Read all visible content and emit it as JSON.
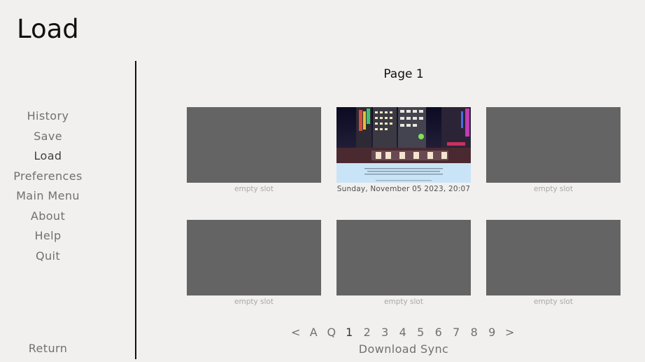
{
  "screen": {
    "title": "Load"
  },
  "nav": {
    "items": [
      {
        "label": "History"
      },
      {
        "label": "Save"
      },
      {
        "label": "Load"
      },
      {
        "label": "Preferences"
      },
      {
        "label": "Main Menu"
      },
      {
        "label": "About"
      },
      {
        "label": "Help"
      },
      {
        "label": "Quit"
      }
    ],
    "active": "Load",
    "return_label": "Return"
  },
  "page": {
    "label": "Page 1"
  },
  "slots": [
    {
      "caption": "empty slot",
      "empty": true
    },
    {
      "caption": "Sunday, November 05 2023, 20:07",
      "empty": false,
      "thumbnail": "night-street-scene"
    },
    {
      "caption": "empty slot",
      "empty": true
    },
    {
      "caption": "empty slot",
      "empty": true
    },
    {
      "caption": "empty slot",
      "empty": true
    },
    {
      "caption": "empty slot",
      "empty": true
    }
  ],
  "pager": {
    "items": [
      "<",
      "A",
      "Q",
      "1",
      "2",
      "3",
      "4",
      "5",
      "6",
      "7",
      "8",
      "9",
      ">"
    ],
    "current": "1"
  },
  "sync": {
    "label": "Download Sync"
  },
  "colors": {
    "background": "#f1f0ee",
    "slot_empty": "#646464",
    "divider": "#111111",
    "nav_text": "#707070",
    "nav_active": "#404040"
  }
}
